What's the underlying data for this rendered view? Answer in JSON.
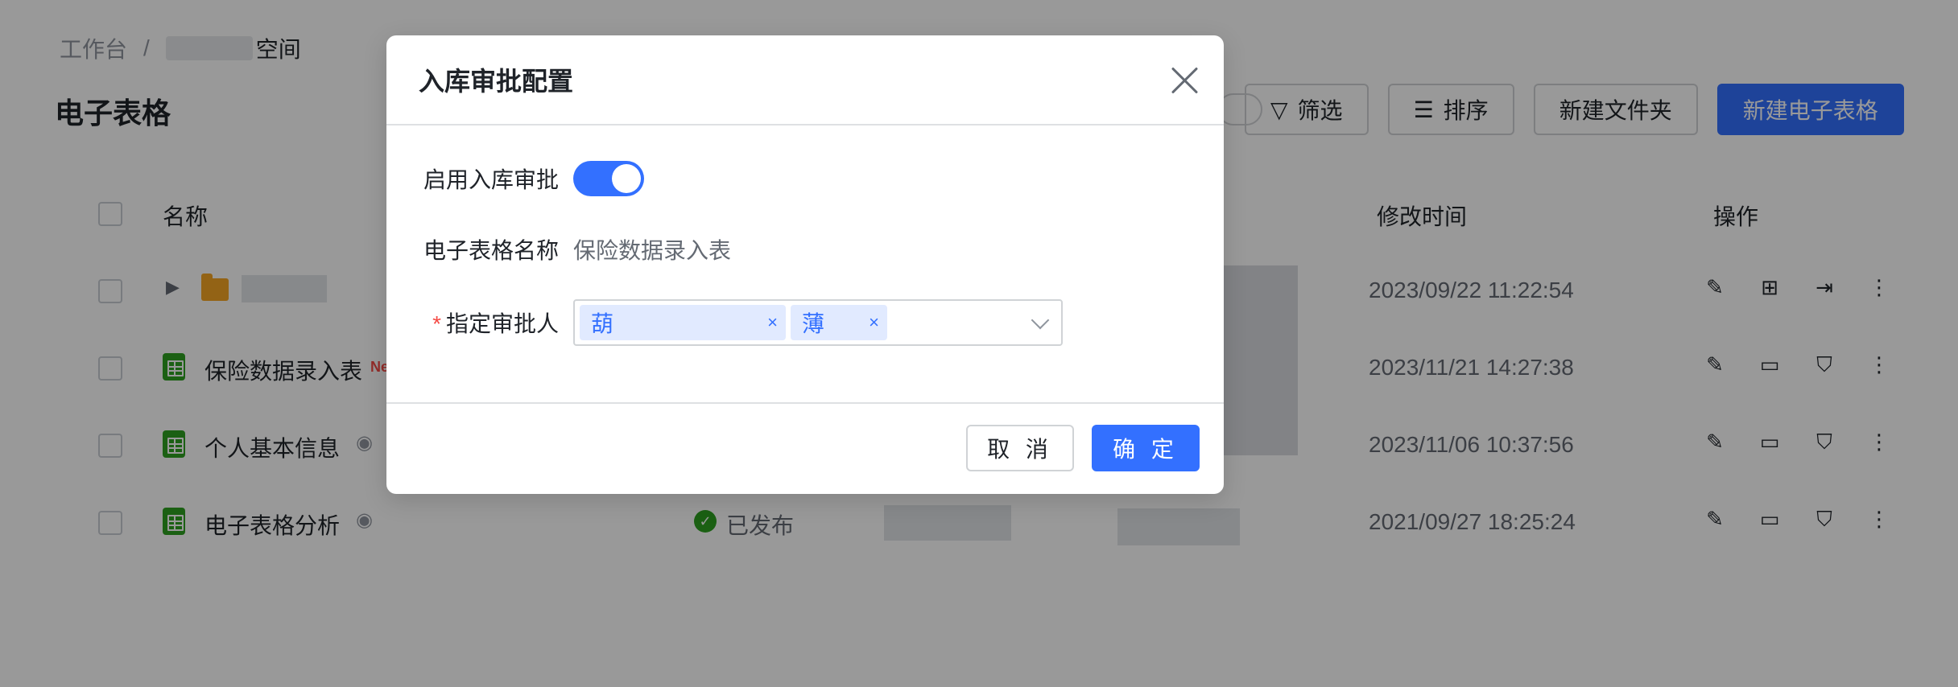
{
  "breadcrumb": {
    "root": "工作台",
    "separator": "/",
    "space": "空间"
  },
  "page_title": "电子表格",
  "toolbar": {
    "filter": "筛选",
    "sort": "排序",
    "new_folder": "新建文件夹",
    "new_sheet": "新建电子表格"
  },
  "table": {
    "col_name": "名称",
    "col_modified": "修改时间",
    "col_actions": "操作",
    "rows": [
      {
        "name": "",
        "modified": "2023/09/22 11:22:54"
      },
      {
        "name": "保险数据录入表",
        "tag": "Ne",
        "modified": "2023/11/21 14:27:38"
      },
      {
        "name": "个人基本信息",
        "modified": "2023/11/06 10:37:56"
      },
      {
        "name": "电子表格分析",
        "status": "已发布",
        "modified": "2021/09/27 18:25:24"
      }
    ]
  },
  "modal": {
    "title": "入库审批配置",
    "enable_label": "启用入库审批",
    "enable_on": true,
    "sheet_name_label": "电子表格名称",
    "sheet_name_value": "保险数据录入表",
    "approver_required": "*",
    "approver_label": "指定审批人",
    "approvers": [
      "葫",
      "薄"
    ],
    "chip_remove": "×",
    "cancel": "取 消",
    "ok": "确 定"
  },
  "colors": {
    "primary": "#3370ff",
    "success": "#2ea121",
    "danger": "#f54a45",
    "overlay": "rgba(0,0,0,0.40)"
  }
}
